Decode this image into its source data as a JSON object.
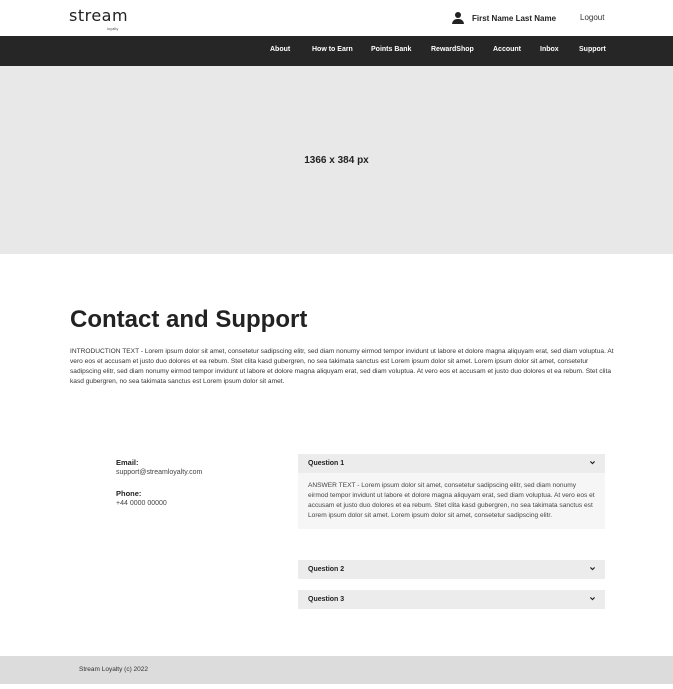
{
  "header": {
    "logo_word": "stream",
    "logo_tag": "loyalty",
    "user_name": "First Name Last Name",
    "logout_label": "Logout"
  },
  "nav": {
    "items": [
      "About",
      "How to Earn",
      "Points Bank",
      "RewardShop",
      "Account",
      "Inbox",
      "Support"
    ]
  },
  "hero": {
    "label": "1366 x 384 px"
  },
  "main": {
    "title": "Contact and Support",
    "intro": "INTRODUCTION TEXT - Lorem ipsum dolor sit amet, consetetur sadipscing elitr, sed diam nonumy eirmod tempor invidunt ut labore et dolore magna aliquyam erat, sed diam voluptua. At vero eos et accusam et justo duo dolores et ea rebum. Stet clita kasd gubergren, no sea takimata sanctus est Lorem ipsum dolor sit amet. Lorem ipsum dolor sit amet, consetetur sadipscing elitr, sed diam nonumy eirmod tempor invidunt ut labore et dolore magna aliquyam erat, sed diam voluptua. At vero eos et accusam et justo duo dolores et ea rebum. Stet clita kasd gubergren, no sea takimata sanctus est Lorem ipsum dolor sit amet."
  },
  "contact": {
    "email_label": "Email:",
    "email_value": "support@streamloyalty.com",
    "phone_label": "Phone:",
    "phone_value": "+44 0000 00000"
  },
  "faq": {
    "items": [
      {
        "question": "Question 1",
        "answer": "ANSWER TEXT - Lorem ipsum dolor sit amet, consetetur sadipscing elitr, sed diam nonumy eirmod tempor invidunt ut labore et dolore magna aliquyam erat, sed diam voluptua. At vero eos et accusam et justo duo dolores et ea rebum. Stet clita kasd gubergren, no sea takimata sanctus est Lorem ipsum dolor sit amet. Lorem ipsum dolor sit amet, consetetur sadipscing elitr."
      },
      {
        "question": "Question 2"
      },
      {
        "question": "Question 3"
      }
    ],
    "chevron_icon": "chevron-down-icon"
  },
  "footer": {
    "text": "Stream Loyalty (c) 2022"
  }
}
